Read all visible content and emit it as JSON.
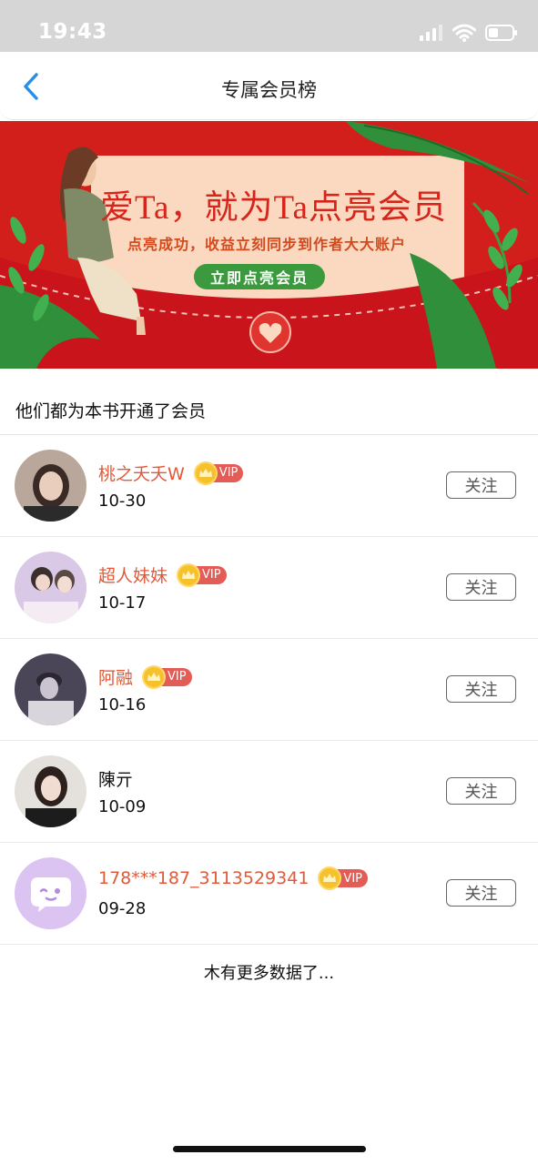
{
  "status_bar": {
    "time": "19:43"
  },
  "nav": {
    "title": "专属会员榜"
  },
  "banner": {
    "headline": "爱Ta，就为Ta点亮会员",
    "subtitle": "点亮成功，收益立刻同步到作者大大账户",
    "cta": "立即点亮会员"
  },
  "section": {
    "title": "他们都为本书开通了会员"
  },
  "members": [
    {
      "name": "桃之夭夭W",
      "date": "10-30",
      "vip": true,
      "vip_label": "VIP",
      "follow_label": "关注"
    },
    {
      "name": "超人妹妹",
      "date": "10-17",
      "vip": true,
      "vip_label": "VIP",
      "follow_label": "关注"
    },
    {
      "name": "阿融",
      "date": "10-16",
      "vip": true,
      "vip_label": "VIP",
      "follow_label": "关注"
    },
    {
      "name": "陳亓",
      "date": "10-09",
      "vip": false,
      "follow_label": "关注"
    },
    {
      "name": "178***187_3113529341",
      "date": "09-28",
      "vip": true,
      "vip_label": "VIP",
      "follow_label": "关注"
    }
  ],
  "footer": {
    "note": "木有更多数据了..."
  },
  "colors": {
    "accent_blue": "#2a8ee8",
    "vip_name": "#e05a3a",
    "banner_red": "#d21f1c",
    "cta_green": "#3b9a3e"
  }
}
